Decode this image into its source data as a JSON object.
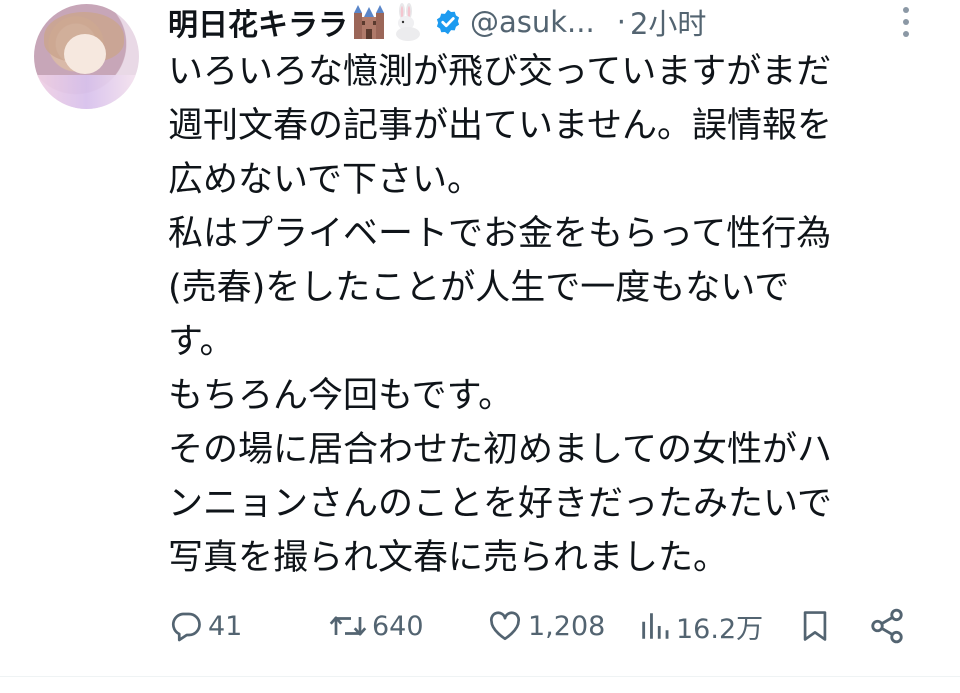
{
  "tweet": {
    "author_name": "明日花キララ",
    "author_emoji": [
      "castle-emoji",
      "rabbit-emoji"
    ],
    "handle": "@asuk...",
    "separator": "·",
    "time": "2小时",
    "lines": [
      "いろいろな憶測が飛び交っていますがまだ",
      "週刊文春の記事が出ていません。誤情報を",
      "広めないで下さい。",
      "私はプライベートでお金をもらって性行為",
      "(売春)をしたことが人生で一度もないで",
      "す。",
      "もちろん今回もです。",
      "その場に居合わせた初めましての女性がハ",
      "ンニョンさんのことを好きだったみたいで",
      "写真を撮られ文春に売られました。"
    ]
  },
  "actions": {
    "replies": "41",
    "reposts": "640",
    "likes": "1,208",
    "views": "16.2万"
  },
  "icons": {
    "reply": "reply-icon",
    "repost": "repost-icon",
    "like": "heart-icon",
    "views": "views-icon",
    "bookmark": "bookmark-icon",
    "share": "share-icon",
    "more": "more-icon",
    "verified": "verified-badge-icon"
  },
  "colors": {
    "text": "#0f1419",
    "secondary": "#536471",
    "verified": "#1d9bf0"
  }
}
